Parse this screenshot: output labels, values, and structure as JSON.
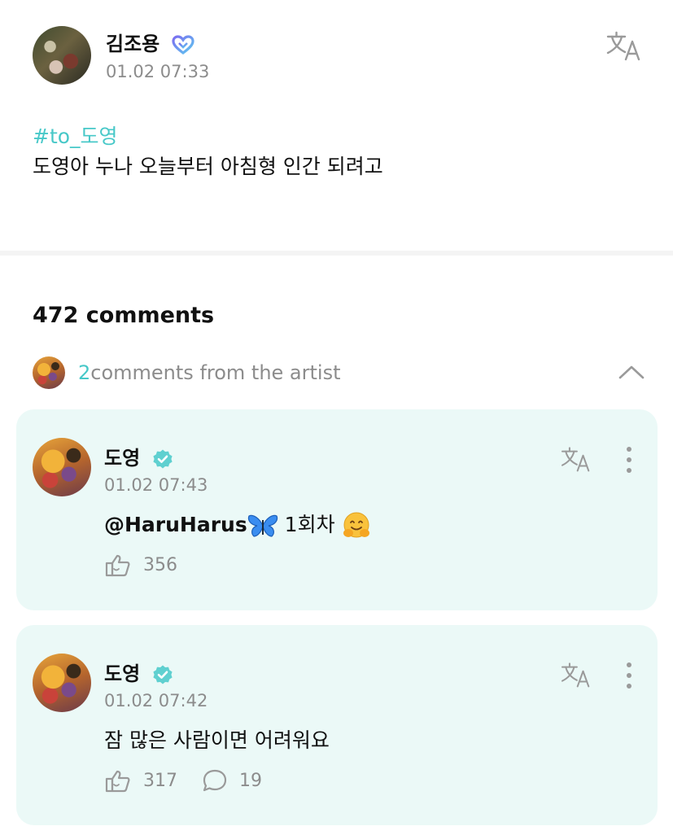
{
  "post": {
    "author": "김조용",
    "timestamp": "01.02 07:33",
    "hashtag": "#to_도영",
    "body": "도영아 누나 오늘부터 아침형 인간 되려고",
    "translate_icon": "translate-icon",
    "badge_icon": "heart-badge-icon"
  },
  "comments_header": {
    "count_label": "472 comments"
  },
  "artist_comments": {
    "count": "2",
    "label": "comments from the artist",
    "toggle_icon": "chevron-up-icon"
  },
  "comments": [
    {
      "author": "도영",
      "timestamp": "01.02 07:43",
      "mention": "@HaruHarus",
      "text": " 1회차 ",
      "likes": "356",
      "reply_count": ""
    },
    {
      "author": "도영",
      "timestamp": "01.02 07:42",
      "mention": "",
      "text": "잠 많은 사람이면 어려워요",
      "likes": "317",
      "reply_count": "19"
    }
  ],
  "colors": {
    "accent": "#47c8c8",
    "card_bg": "#ebf9f7",
    "muted_text": "#8c8c8c",
    "verified": "#5fd0d0"
  }
}
